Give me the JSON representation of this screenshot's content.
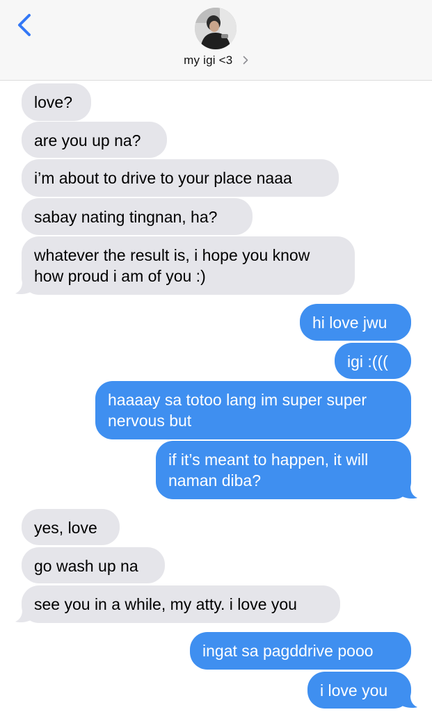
{
  "header": {
    "back_icon": "chevron-left-icon",
    "contact_name": "my igi <3",
    "contact_chevron_icon": "chevron-right-icon",
    "accent_color": "#3478f6"
  },
  "colors": {
    "incoming_bubble": "#e5e5ea",
    "outgoing_bubble": "#3f8ff0"
  },
  "messages": [
    {
      "from": "them",
      "text": "love?"
    },
    {
      "from": "them",
      "text": "are you up na?"
    },
    {
      "from": "them",
      "text": "i’m about to drive to your place naaa"
    },
    {
      "from": "them",
      "text": "sabay nating tingnan, ha?"
    },
    {
      "from": "them",
      "text": "whatever the result is, i hope you know how proud i am of you :)"
    },
    {
      "from": "me",
      "text": "hi love jwu"
    },
    {
      "from": "me",
      "text": "igi :((("
    },
    {
      "from": "me",
      "text": "haaaay sa totoo lang im super super nervous but"
    },
    {
      "from": "me",
      "text": "if it’s meant to happen, it will naman diba?"
    },
    {
      "from": "them",
      "text": "yes, love"
    },
    {
      "from": "them",
      "text": "go wash up na"
    },
    {
      "from": "them",
      "text": "see you in a while, my atty. i love you"
    },
    {
      "from": "me",
      "text": "ingat sa pagddrive pooo"
    },
    {
      "from": "me",
      "text": "i love you"
    }
  ]
}
